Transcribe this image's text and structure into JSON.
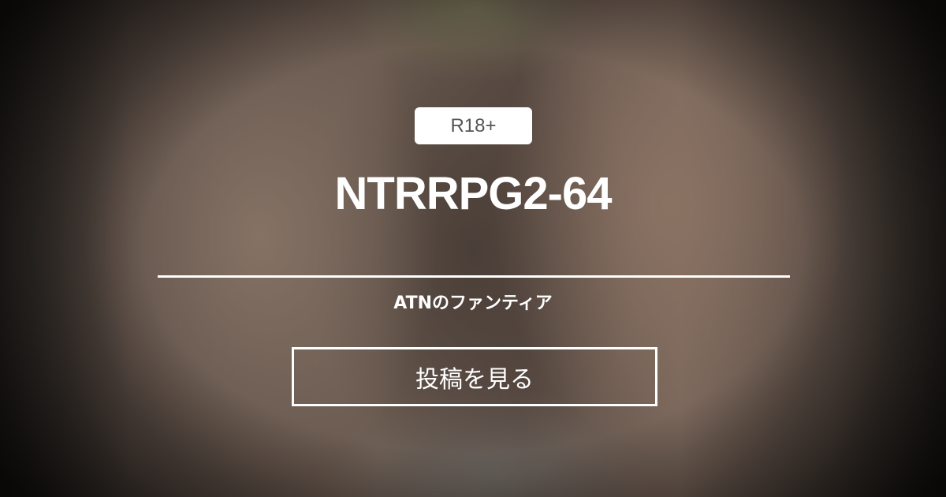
{
  "badge": {
    "label": "R18+"
  },
  "post": {
    "title": "NTRRPG2-64"
  },
  "creator": {
    "name": "ATNのファンティア"
  },
  "actions": {
    "view_post_label": "投稿を見る"
  },
  "colors": {
    "text": "#ffffff",
    "badge_bg": "#ffffff",
    "badge_text": "#555555"
  }
}
